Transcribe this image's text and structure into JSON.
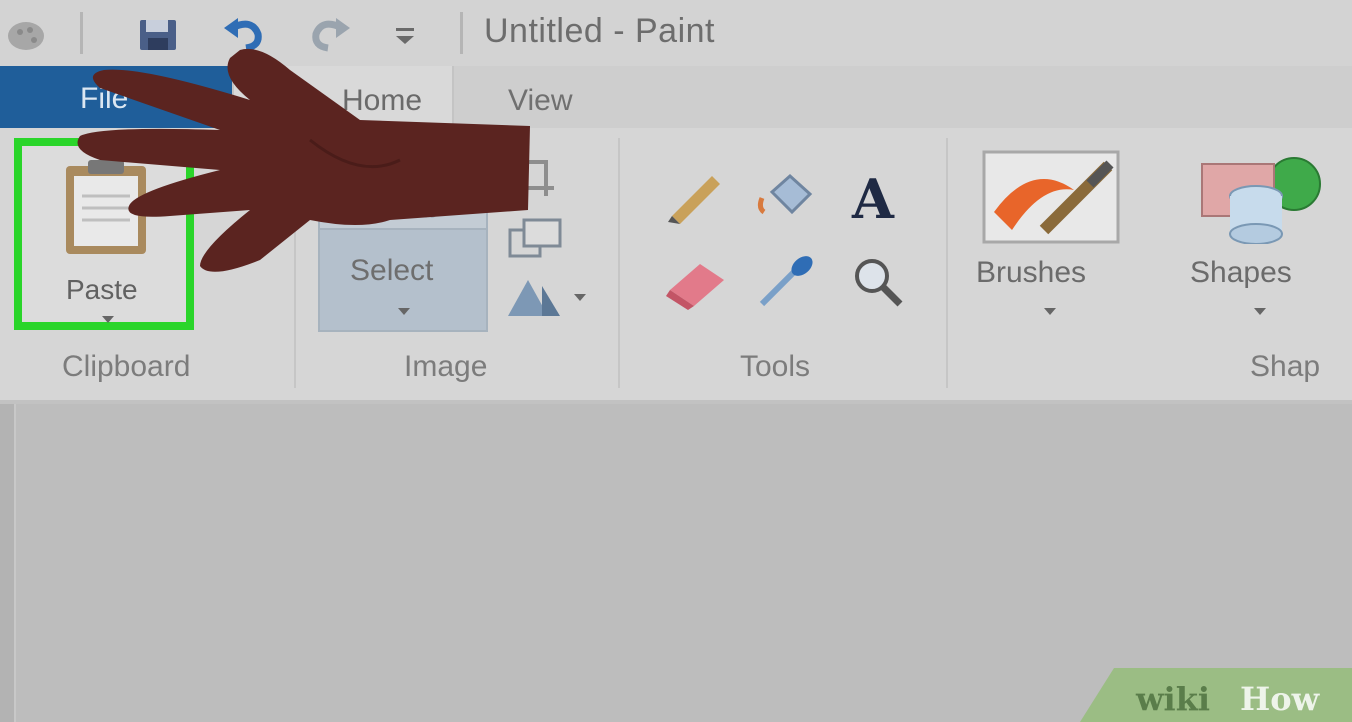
{
  "window": {
    "title": "Untitled - Paint"
  },
  "tabs": {
    "file": "File",
    "home": "Home",
    "view": "View"
  },
  "clipboard": {
    "paste_label": "Paste",
    "group_label": "Clipboard"
  },
  "image": {
    "select_label": "Select",
    "group_label": "Image"
  },
  "tools": {
    "group_label": "Tools",
    "items": [
      "pencil-icon",
      "fill-icon",
      "text-icon",
      "eraser-icon",
      "color-picker-icon",
      "magnifier-icon"
    ]
  },
  "brushes": {
    "label": "Brushes"
  },
  "shapes": {
    "label": "Shapes",
    "group_label": "Shap"
  },
  "watermark": {
    "wiki": "wiki",
    "how": "How"
  },
  "colors": {
    "highlight": "#2ad52a",
    "file_tab": "#1f5e9a",
    "hand": "#5b2420"
  }
}
